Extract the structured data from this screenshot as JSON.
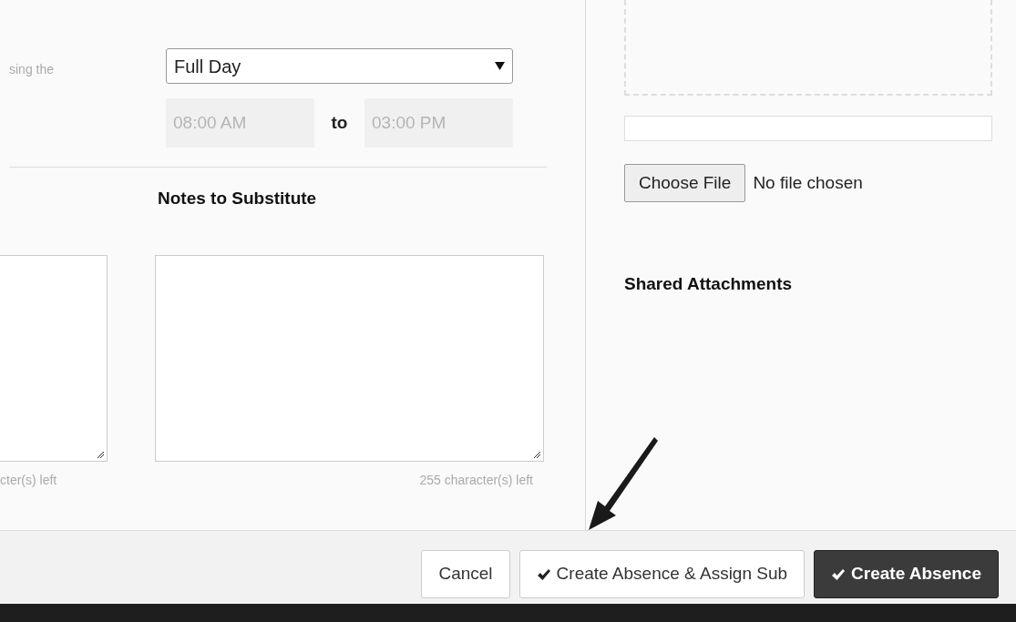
{
  "left_panel": {
    "cut_label": "sing the",
    "duration_select": {
      "value": "Full Day"
    },
    "start_time": {
      "value": "08:00 AM",
      "disabled": true
    },
    "time_separator": "to",
    "end_time": {
      "value": "03:00 PM",
      "disabled": true
    },
    "notes_heading": "Notes to Substitute",
    "left_counter": "cter(s) left",
    "notes_counter": "255 character(s) left"
  },
  "right_panel": {
    "upload_progress": {
      "level": 0
    },
    "choose_file_button": "Choose File",
    "file_status": "No file chosen",
    "shared_heading": "Shared Attachments"
  },
  "footer": {
    "buttons": [
      {
        "label": "Cancel",
        "kind": "plain",
        "check": false
      },
      {
        "label": "Create Absence & Assign Sub",
        "kind": "plain",
        "check": true
      },
      {
        "label": "Create Absence",
        "kind": "primary",
        "check": true
      }
    ]
  }
}
